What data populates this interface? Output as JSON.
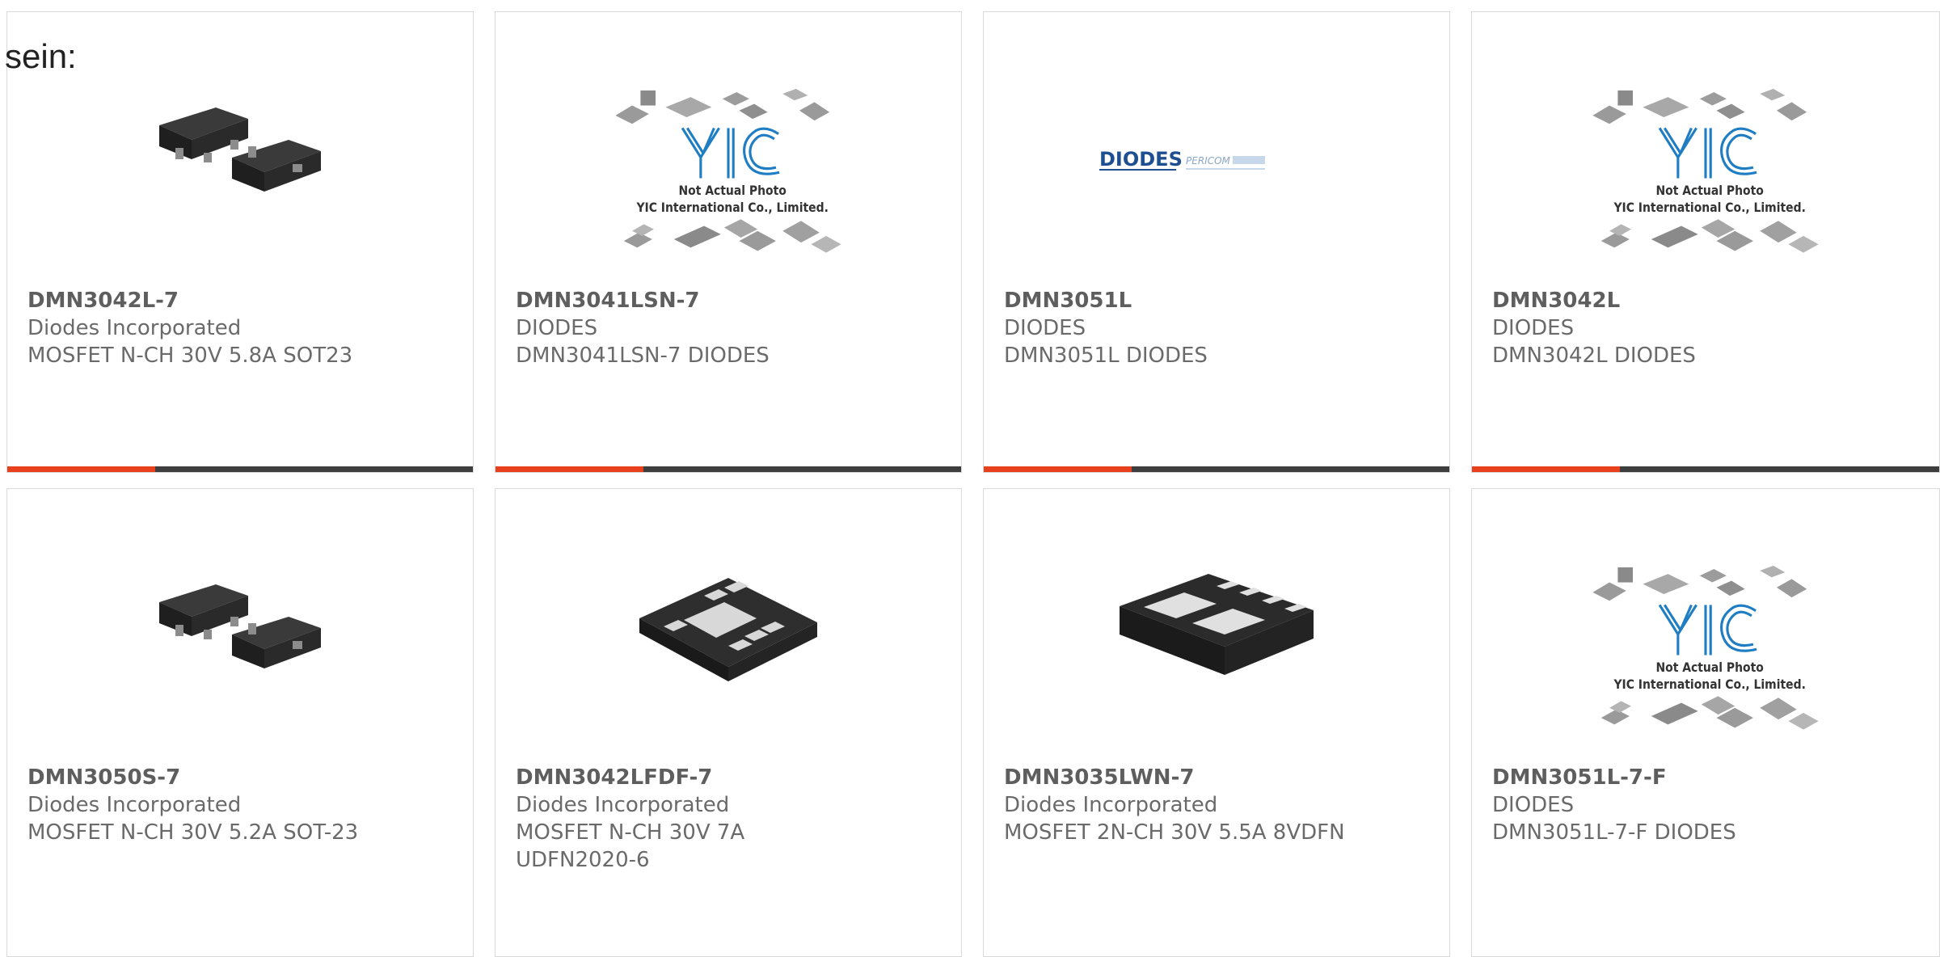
{
  "intro_text": "sein:",
  "colors": {
    "accent": "#e8401c",
    "bar": "#3d3d3d",
    "border": "#d9d9d9"
  },
  "products": [
    {
      "part": "DMN3042L-7",
      "manufacturer": "Diodes Incorporated",
      "description": "MOSFET N-CH 30V 5.8A SOT23",
      "image": "sot23-chip-icon"
    },
    {
      "part": "DMN3041LSN-7",
      "manufacturer": "DIODES",
      "description": "DMN3041LSN-7 DIODES",
      "image": "yic-placeholder",
      "placeholder_lines": [
        "Not Actual Photo",
        "YIC International Co., Limited."
      ]
    },
    {
      "part": "DMN3051L",
      "manufacturer": "DIODES",
      "description": "DMN3051L DIODES",
      "image": "diodes-pericom-logo",
      "logo_text": [
        "DIODES",
        "PERICOM"
      ]
    },
    {
      "part": "DMN3042L",
      "manufacturer": "DIODES",
      "description": "DMN3042L DIODES",
      "image": "yic-placeholder",
      "placeholder_lines": [
        "Not Actual Photo",
        "YIC International Co., Limited."
      ]
    },
    {
      "part": "DMN3050S-7",
      "manufacturer": "Diodes Incorporated",
      "description": "MOSFET N-CH 30V 5.2A SOT-23",
      "image": "sot23-chip-icon"
    },
    {
      "part": "DMN3042LFDF-7",
      "manufacturer": "Diodes Incorporated",
      "description": "MOSFET N-CH 30V 7A UDFN2020-6",
      "image": "udfn-chip-icon"
    },
    {
      "part": "DMN3035LWN-7",
      "manufacturer": "Diodes Incorporated",
      "description": "MOSFET 2N-CH 30V 5.5A 8VDFN",
      "image": "vdfn-chip-icon"
    },
    {
      "part": "DMN3051L-7-F",
      "manufacturer": "DIODES",
      "description": "DMN3051L-7-F DIODES",
      "image": "yic-placeholder",
      "placeholder_lines": [
        "Not Actual Photo",
        "YIC International Co., Limited."
      ]
    }
  ]
}
